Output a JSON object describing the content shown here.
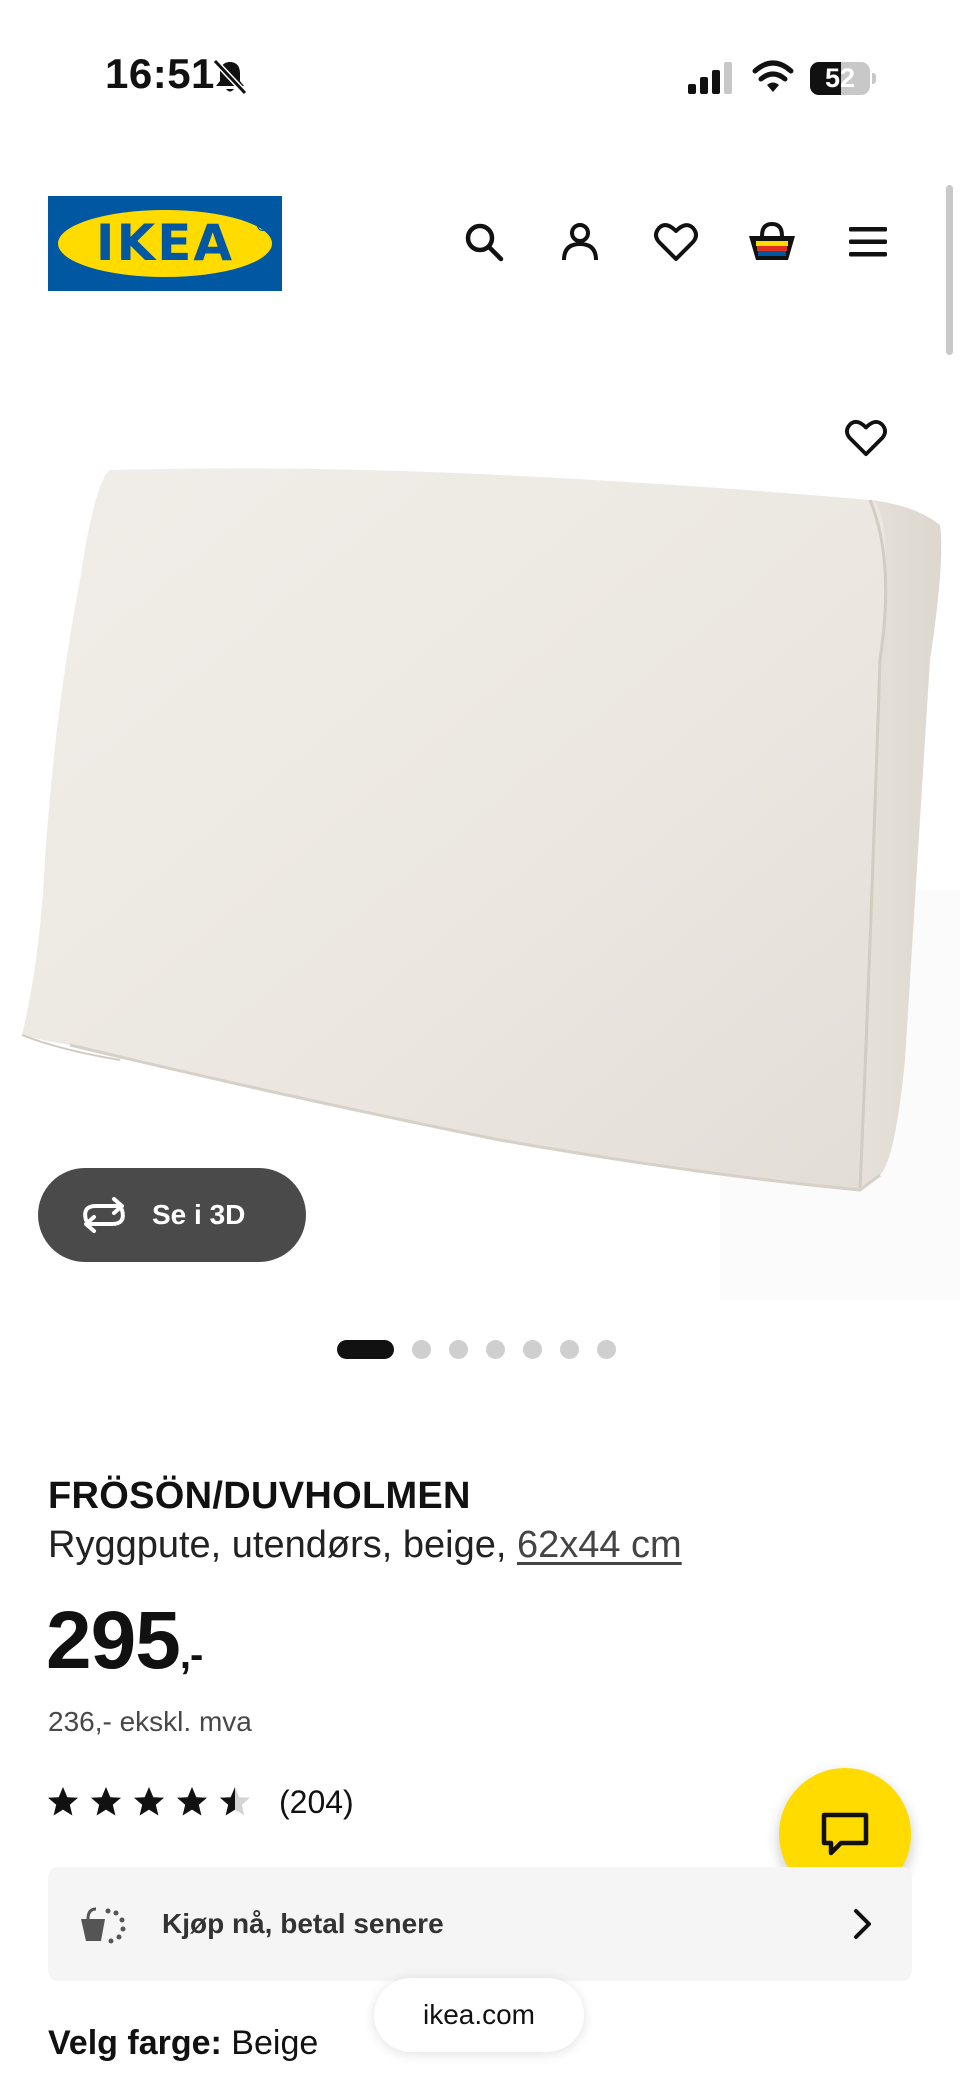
{
  "status_bar": {
    "time": "16:51",
    "battery_level": "52",
    "icons": [
      "bell-slash-icon",
      "cellular-signal-icon",
      "wifi-icon",
      "battery-icon"
    ]
  },
  "header": {
    "logo_text": "IKEA",
    "icons": [
      "search-icon",
      "account-icon",
      "heart-icon",
      "shopping-bag-icon",
      "menu-icon"
    ]
  },
  "gallery": {
    "view_3d_label": "Se i 3D",
    "slide_count": 7,
    "active_slide": 1
  },
  "product": {
    "name": "FRÖSÖN/DUVHOLMEN",
    "description": "Ryggpute, utendørs, beige,",
    "size_link": "62x44 cm",
    "price_main": "295",
    "price_suffix": ",-",
    "price_ex_vat": "236,- ekskl. mva",
    "rating_value": 4.5,
    "rating_count": "(204)"
  },
  "buy_now_pay_later": {
    "label": "Kjøp nå, betal senere"
  },
  "color": {
    "label": "Velg farge:",
    "value": "Beige"
  },
  "browser": {
    "url": "ikea.com"
  },
  "colors": {
    "ikea_blue": "#0058a3",
    "ikea_yellow": "#ffdb00",
    "dark_button": "#4a4a4a"
  }
}
